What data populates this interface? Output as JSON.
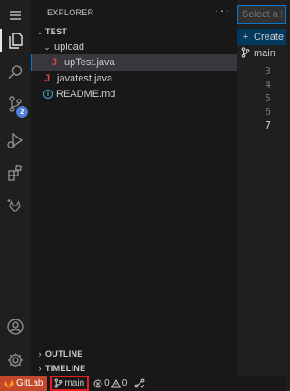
{
  "activity_bar": {
    "items": [
      {
        "name": "menu-icon"
      },
      {
        "name": "explorer-icon"
      },
      {
        "name": "search-icon"
      },
      {
        "name": "source-control-icon",
        "badge": "2"
      },
      {
        "name": "run-debug-icon"
      },
      {
        "name": "extensions-icon"
      },
      {
        "name": "gitlab-workflow-icon"
      }
    ],
    "bottom": [
      {
        "name": "accounts-icon"
      },
      {
        "name": "settings-gear-icon"
      }
    ]
  },
  "sidebar": {
    "title": "EXPLORER",
    "more": "···",
    "tree": {
      "root": "TEST",
      "folder": "upload",
      "files": [
        {
          "label": "upTest.java",
          "type": "java",
          "selected": true
        },
        {
          "label": "javatest.java",
          "type": "java"
        },
        {
          "label": "README.md",
          "type": "info"
        }
      ]
    },
    "sections": [
      "OUTLINE",
      "TIMELINE"
    ]
  },
  "editor": {
    "line_numbers": [
      "3",
      "4",
      "5",
      "6",
      "7"
    ],
    "current_line": "7"
  },
  "quick_pick": {
    "placeholder": "Select a branch",
    "items": [
      {
        "label": "Create",
        "icon": "plus-icon",
        "selected": true
      },
      {
        "label": "main",
        "icon": "git-branch-icon"
      }
    ]
  },
  "status_bar": {
    "gitlab": "GitLab",
    "branch": "main",
    "errors": "0",
    "warnings": "0"
  },
  "colors": {
    "accent": "#0078d4",
    "gitlab": "#c3472a",
    "badge": "#4e7fda",
    "highlight_border": "#e81e1e"
  }
}
